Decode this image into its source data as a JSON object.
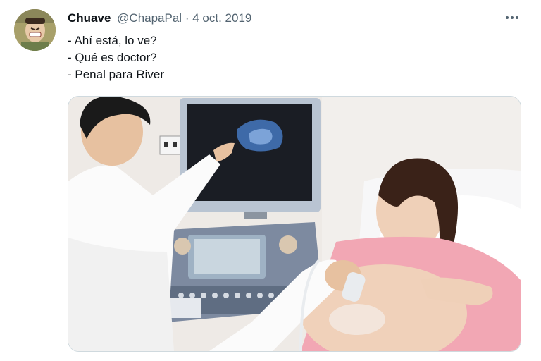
{
  "tweet": {
    "author_name": "Chuave",
    "author_handle": "@ChapaPal",
    "separator": "·",
    "date": "4 oct. 2019",
    "lines": [
      "- Ahí está, lo ve?",
      "- Qué es doctor?",
      "- Penal para River"
    ]
  },
  "icons": {
    "avatar": "avatar-image",
    "more": "more-icon"
  },
  "colors": {
    "text_primary": "#0f1419",
    "text_secondary": "#536471",
    "media_border": "#cfd9de"
  }
}
